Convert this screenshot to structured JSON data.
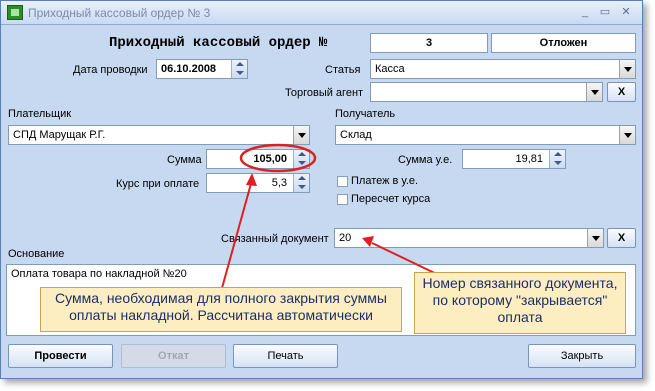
{
  "window": {
    "title": "Приходный кассовый ордер № 3",
    "controls": {
      "minimize": "_",
      "maximize": "▭",
      "close": "✕"
    }
  },
  "header": {
    "doc_title": "Приходный кассовый ордер №",
    "doc_number": "3",
    "doc_status": "Отложен"
  },
  "fields": {
    "posting_date_label": "Дата проводки",
    "posting_date_value": "06.10.2008",
    "article_label": "Статья",
    "article_value": "Касса",
    "agent_label": "Торговый агент",
    "agent_value": "",
    "payer_label": "Плательщик",
    "payer_value": "СПД Марущак Р.Г.",
    "recipient_label": "Получатель",
    "recipient_value": "Склад",
    "sum_label": "Сумма",
    "sum_value": "105,00",
    "sum_ue_label": "Сумма у.е.",
    "sum_ue_value": "19,81",
    "rate_label": "Курс при оплате",
    "rate_value": "5,3",
    "pay_ue_label": "Платеж в у.е.",
    "recalc_label": "Пересчет курса",
    "linked_doc_label": "Связанный документ",
    "linked_doc_value": "20",
    "basis_label": "Основание",
    "basis_value": "Оплата товара по накладной №20",
    "clear_label": "X"
  },
  "callouts": {
    "left": "Сумма, необходимая для полного закрытия суммы оплаты накладной. Рассчитана автоматически",
    "right": "Номер связанного документа, по которому \"закрывается\" оплата"
  },
  "buttons": {
    "post": "Провести",
    "rollback": "Откат",
    "print": "Печать",
    "close": "Закрыть"
  },
  "colors": {
    "window_bg": "#c6d9f1",
    "highlight_circle": "#e02020",
    "arrow": "#e02020",
    "callout_bg": "#fdeec2"
  }
}
